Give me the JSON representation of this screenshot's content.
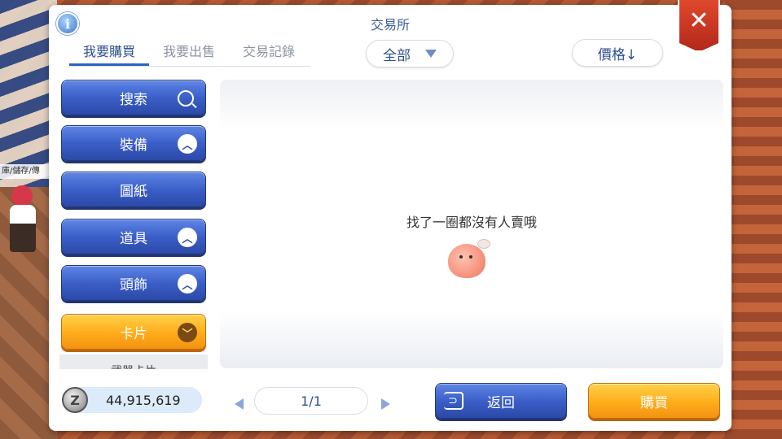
{
  "npc_label": "庫/儲存/傳",
  "panel": {
    "title": "交易所",
    "info_icon": "i",
    "close_icon": "✕"
  },
  "tabs": [
    {
      "label": "我要購買",
      "active": true
    },
    {
      "label": "我要出售",
      "active": false
    },
    {
      "label": "交易記錄",
      "active": false
    }
  ],
  "filter": {
    "selected": "全部",
    "icon": "triangle-down-icon"
  },
  "sort": {
    "label": "價格↓"
  },
  "sidebar": {
    "items": [
      {
        "label": "搜索",
        "icon": "search-icon"
      },
      {
        "label": "裝備",
        "icon": "chevron-up-icon"
      },
      {
        "label": "圖紙",
        "icon": ""
      },
      {
        "label": "道具",
        "icon": "chevron-up-icon"
      },
      {
        "label": "頭飾",
        "icon": "chevron-up-icon"
      },
      {
        "label": "卡片",
        "icon": "chevron-down-icon",
        "expanded": true
      }
    ],
    "subitem": "武器卡片"
  },
  "results": {
    "empty_message": "找了一圈都沒有人賣哦"
  },
  "footer": {
    "currency_symbol": "Z",
    "currency_value": "44,915,619",
    "page": "1/1",
    "back_label": "返回",
    "buy_label": "購買"
  },
  "colors": {
    "blue_button": "#3b5fc8",
    "orange_button": "#ffac1a",
    "close_red": "#d33b24",
    "title_blue": "#3c5f9c"
  }
}
